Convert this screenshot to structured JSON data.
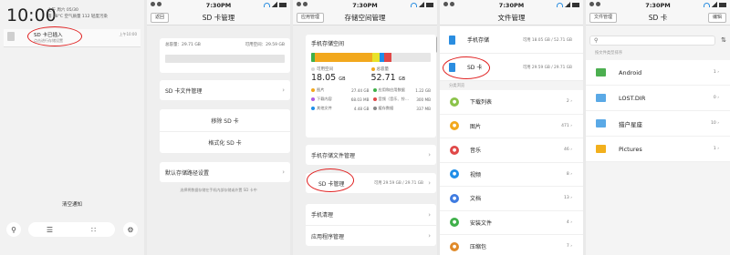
{
  "status": {
    "time": "7:30PM"
  },
  "p1": {
    "clock": "10:00",
    "info_line1": "上午 周六 05/30",
    "info_line2": "雨 18°C 空气质量 112 轻度污染",
    "notif_title": "SD 卡已插入",
    "notif_sub": "点击进行存储设置",
    "notif_time": "上午10:00",
    "clear_label": "清空通知",
    "btn_search_icon": "search-icon",
    "btn_settings_icon": "gear-icon"
  },
  "p2": {
    "back_label": "返回",
    "title": "SD 卡管理",
    "total_label": "总容量：29.71 GB",
    "avail_label": "可用空间：29.59 GB",
    "available_fraction": 0.996,
    "file_mgmt_label": "SD 卡文件管理",
    "remove_label": "移除 SD 卡",
    "format_label": "格式化 SD 卡",
    "default_storage_label": "默认存储路径设置",
    "note": "选择将数据存储在手机内部存储或外置 SD 卡中"
  },
  "p3": {
    "back_label": "应用管理",
    "title": "存储空间管理",
    "card_title": "手机存储空间",
    "available_label": "可用空间",
    "available_value": "18.05",
    "available_unit": "GB",
    "used_label": "总容量",
    "used_value": "52.71",
    "used_unit": "GB",
    "bar_segments": [
      {
        "color": "#3fb04a",
        "fraction": 0.03
      },
      {
        "color": "#f2a81d",
        "fraction": 0.48
      },
      {
        "color": "#e8e22a",
        "fraction": 0.06
      },
      {
        "color": "#1f8ee8",
        "fraction": 0.04
      },
      {
        "color": "#e04848",
        "fraction": 0.06
      }
    ],
    "categories": [
      {
        "name": "图片",
        "value": "27.44 GB",
        "color": "#f2a81d"
      },
      {
        "name": "应用和应用数据",
        "value": "1.22 GB",
        "color": "#3fb04a"
      },
      {
        "name": "下载内容",
        "value": "68.03 MB",
        "color": "#b05ce0"
      },
      {
        "name": "音频（音乐、铃…",
        "value": "300 MB",
        "color": "#e04848"
      },
      {
        "name": "其他文件",
        "value": "4.48 GB",
        "color": "#1f8ee8"
      },
      {
        "name": "缓存数据",
        "value": "337 MB",
        "color": "#888888"
      }
    ],
    "phone_files_label": "手机存储文件管理",
    "sd_label": "SD 卡管理",
    "sd_value": "可用 29.59 GB / 29.71 GB",
    "cleanup_label": "手机清理",
    "apps_label": "应用程序管理"
  },
  "p4": {
    "title": "文件管理",
    "phone_label": "手机存储",
    "phone_value": "可用 18.05 GB / 52.71 GB",
    "sd_label": "SD 卡",
    "sd_value": "可用 29.59 GB / 29.71 GB",
    "section_label": "分类浏览",
    "items": [
      {
        "name": "下载列表",
        "count": "2",
        "color": "#8bc34a",
        "icon": "download-icon"
      },
      {
        "name": "图片",
        "count": "471",
        "color": "#f2a81d",
        "icon": "image-icon"
      },
      {
        "name": "音乐",
        "count": "46",
        "color": "#e04848",
        "icon": "music-icon"
      },
      {
        "name": "视频",
        "count": "8",
        "color": "#1f8ee8",
        "icon": "video-icon"
      },
      {
        "name": "文档",
        "count": "13",
        "color": "#3f7be0",
        "icon": "document-icon"
      },
      {
        "name": "安装文件",
        "count": "4",
        "color": "#3fb04a",
        "icon": "package-icon"
      },
      {
        "name": "压缩包",
        "count": "7",
        "color": "#e08a2a",
        "icon": "archive-icon"
      }
    ]
  },
  "p5": {
    "back_label": "文件管理",
    "title": "SD 卡",
    "edit_label": "编辑",
    "section_label": "按文件类型排序",
    "folders": [
      {
        "name": "Android",
        "count": "1",
        "color": "#4caf50",
        "icon": "android-folder-icon"
      },
      {
        "name": "LOST.DIR",
        "count": "0",
        "color": "#5aa9e6",
        "icon": "folder-icon"
      },
      {
        "name": "猎户星座",
        "count": "10",
        "color": "#5aa9e6",
        "icon": "folder-icon"
      },
      {
        "name": "Pictures",
        "count": "1",
        "color": "#f2b01d",
        "icon": "pictures-folder-icon"
      }
    ]
  }
}
